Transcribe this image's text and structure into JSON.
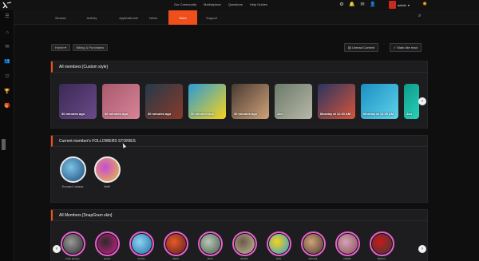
{
  "topbar": {
    "links": [
      "Our Community",
      "Marketplace",
      "Questions",
      "Help Guides"
    ],
    "icons": [
      "gear-icon",
      "bell-icon",
      "mail-icon",
      "user-icon"
    ],
    "admin_label": "admin",
    "theme_icon": "sun-icon"
  },
  "sidebar": {
    "icons": [
      "menu-icon",
      "home-icon",
      "mail-icon",
      "users-icon",
      "groups-icon",
      "trophy-icon",
      "gift-icon"
    ]
  },
  "nav": {
    "items": [
      "Browse",
      "Activity",
      "Applications",
      "News",
      "Store",
      "Support"
    ],
    "active": "Store",
    "caret": "▾"
  },
  "breadcrumbs": [
    "Home",
    "Billing & Purchases"
  ],
  "actions": {
    "unread": "Unread Content",
    "mark_read": "Mark site read"
  },
  "sections": {
    "all_members_custom": "All members [Custom style]",
    "current_followers": "Current member's FOLLOWERS STORIES",
    "all_members_snapgram": "All Members [SnapGram skin]"
  },
  "cards": [
    {
      "caption": "30 minutes ago",
      "colors": [
        "#3a2a55",
        "#6b4a8a"
      ]
    },
    {
      "caption": "30 minutes ago",
      "colors": [
        "#a85a6b",
        "#d8849a"
      ]
    },
    {
      "caption": "30 minutes ago",
      "colors": [
        "#233a4a",
        "#8a3a2a"
      ]
    },
    {
      "caption": "30 minutes ago",
      "colors": [
        "#2a9bd8",
        "#f7d21c"
      ]
    },
    {
      "caption": "30 minutes ago",
      "colors": [
        "#4a3a32",
        "#cfa27a"
      ]
    },
    {
      "caption": "Jan",
      "colors": [
        "#6b7a6a",
        "#b8b8a8"
      ]
    },
    {
      "caption": "Monday at 11:20 AM",
      "colors": [
        "#2a3560",
        "#d6553a"
      ]
    },
    {
      "caption": "Monday at 11:20 AM",
      "colors": [
        "#1b8fc4",
        "#5fd3e8"
      ]
    },
    {
      "caption": "Jan",
      "colors": [
        "#0e9b8a",
        "#2ad0b8"
      ]
    }
  ],
  "followers": [
    {
      "name": "Konrad Lukasz",
      "colors": [
        "#1b4a78",
        "#7dc3e8"
      ]
    },
    {
      "name": "Nelli",
      "colors": [
        "#e8c23a",
        "#c94ad6"
      ]
    }
  ],
  "snapgram": {
    "users": [
      {
        "name": "Fake Quorpy",
        "colors": [
          "#2a2a2a",
          "#9a9a9a"
        ]
      },
      {
        "name": "purple",
        "colors": [
          "#d61f8a",
          "#2a2a2a"
        ]
      },
      {
        "name": "Cezary",
        "colors": [
          "#1d6fa8",
          "#8fd3f0"
        ]
      },
      {
        "name": "Jakub",
        "colors": [
          "#5a1f1f",
          "#e65a2a"
        ]
      },
      {
        "name": "Mark",
        "colors": [
          "#4a5a4a",
          "#b8c8b8"
        ]
      },
      {
        "name": "Emilka",
        "colors": [
          "#c8b89a",
          "#6a5a48"
        ]
      },
      {
        "name": "Nelli",
        "colors": [
          "#2a9bd8",
          "#f7d21c"
        ]
      },
      {
        "name": "Dominik",
        "colors": [
          "#4a3a32",
          "#cfa27a"
        ]
      },
      {
        "name": "Natalia",
        "colors": [
          "#8a4a5a",
          "#d4a4b4"
        ]
      },
      {
        "name": "Bartosz",
        "colors": [
          "#3a3a3a",
          "#c81a1a"
        ]
      }
    ]
  },
  "colors": {
    "accent": "#ef4f1b",
    "panel": "#1d1d1f",
    "background": "#0f0f10"
  }
}
